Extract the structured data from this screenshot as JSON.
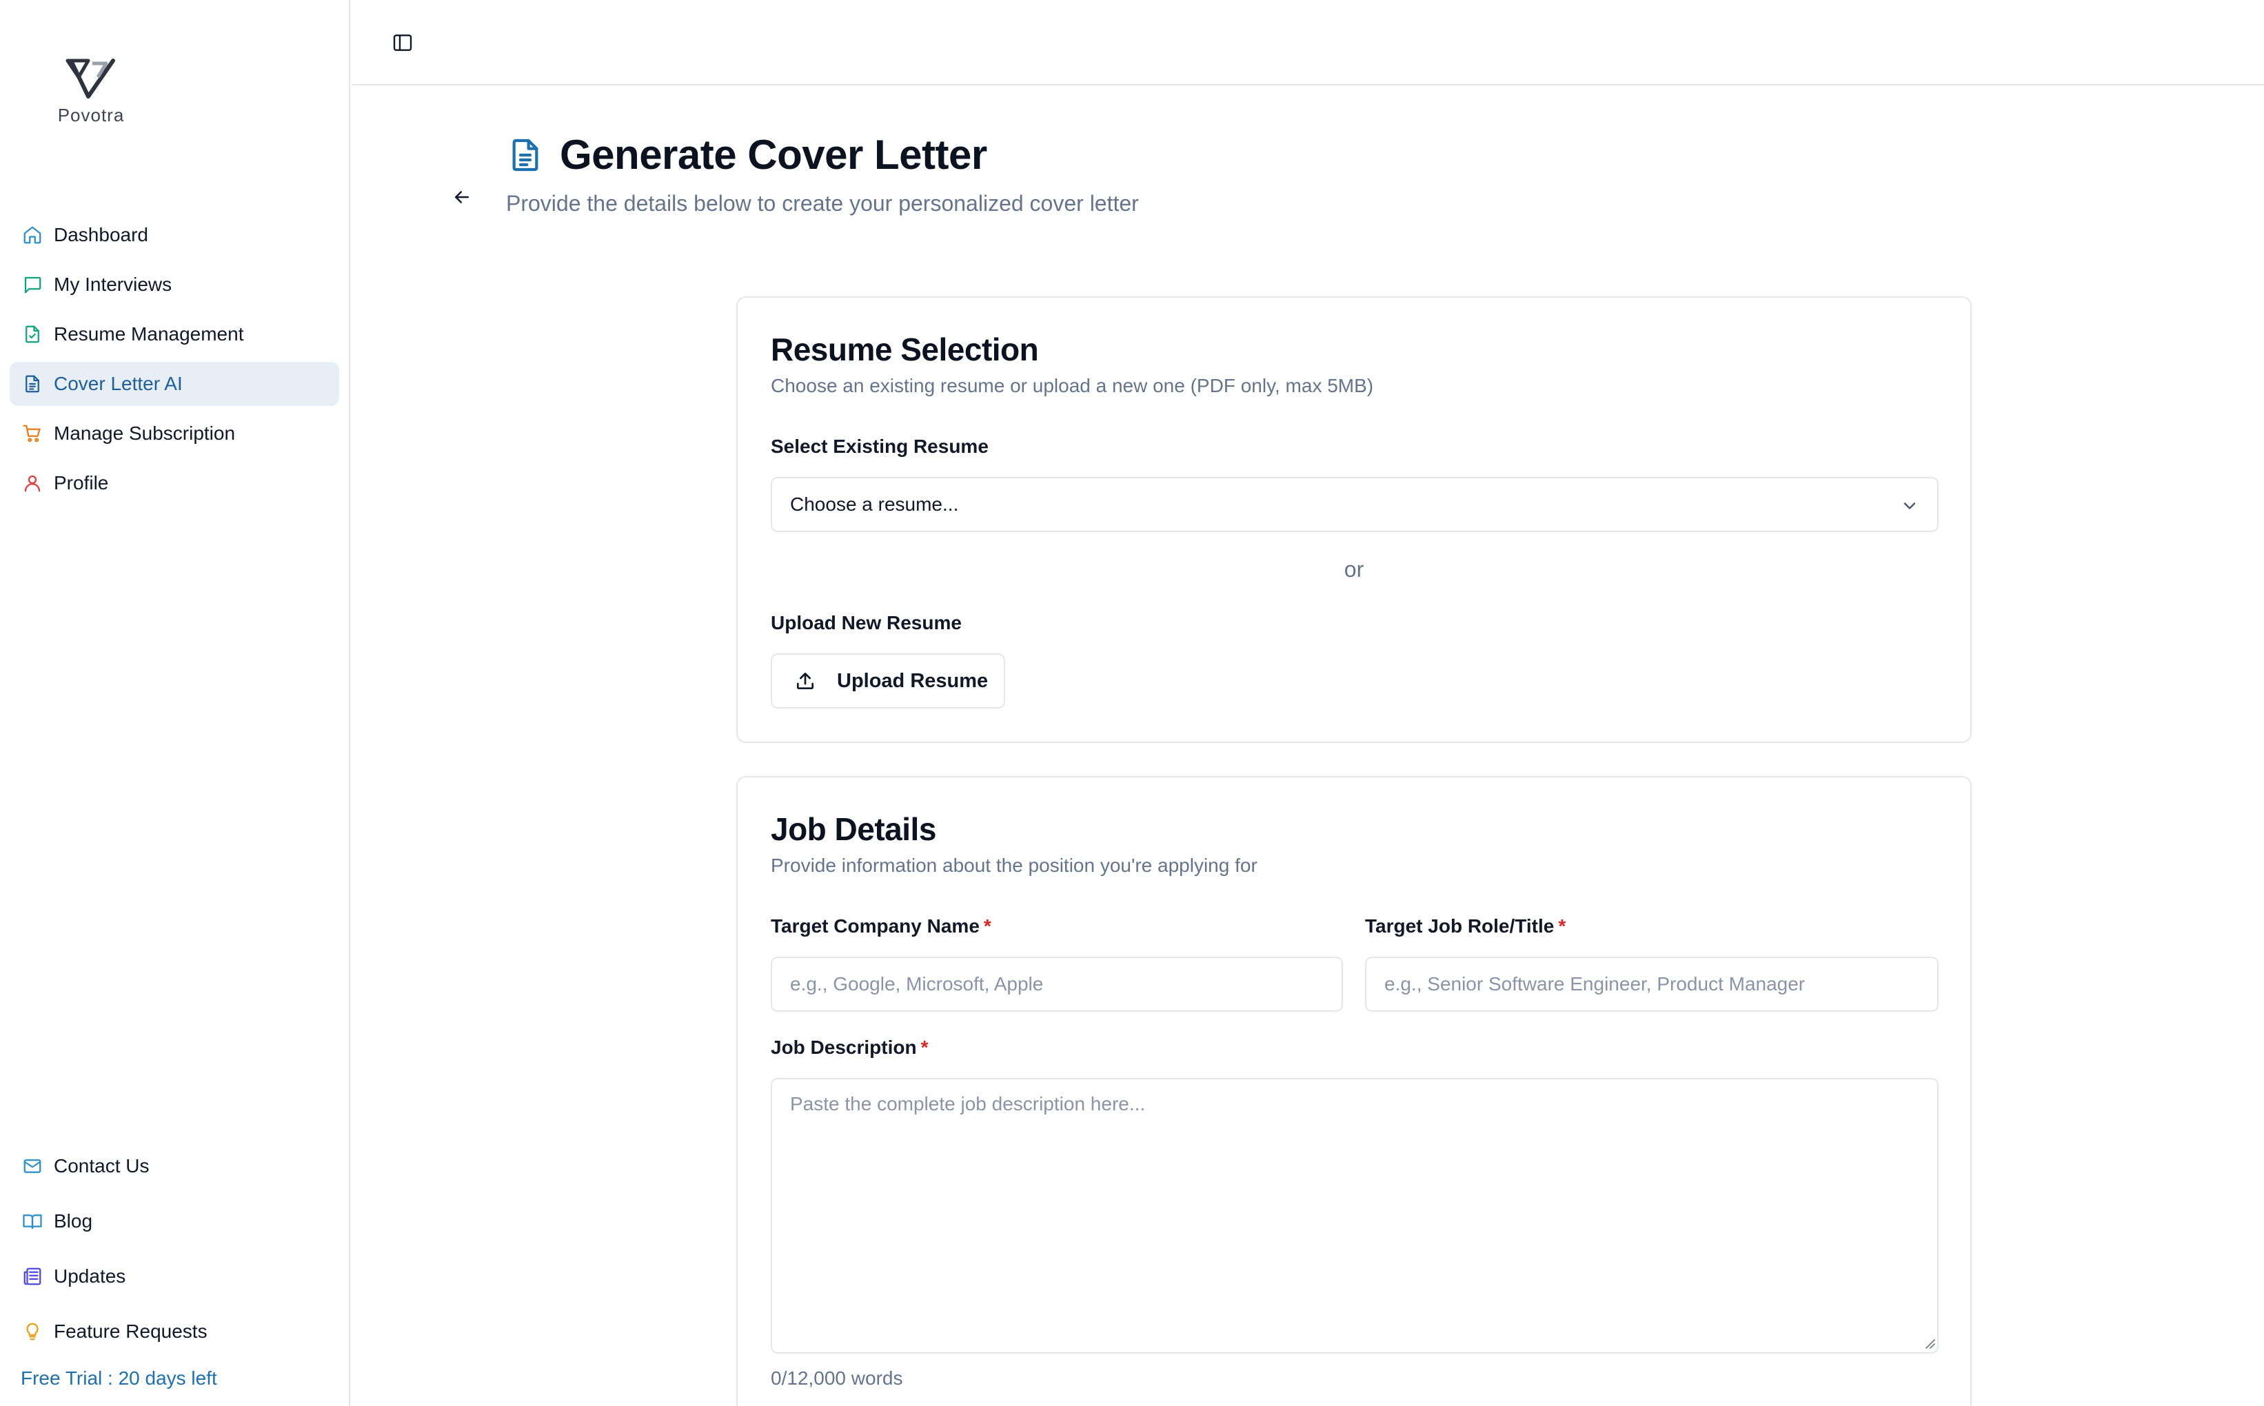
{
  "brand": {
    "name": "Povotra"
  },
  "sidebar": {
    "items": [
      {
        "label": "Dashboard",
        "icon": "home-icon",
        "color": "#2b8fc9"
      },
      {
        "label": "My Interviews",
        "icon": "chat-icon",
        "color": "#10a37f"
      },
      {
        "label": "Resume Management",
        "icon": "file-check-icon",
        "color": "#10a37f"
      },
      {
        "label": "Cover Letter AI",
        "icon": "file-text-icon",
        "color": "#1d5f9b",
        "active": true
      },
      {
        "label": "Manage Subscription",
        "icon": "cart-icon",
        "color": "#ea7a1a"
      },
      {
        "label": "Profile",
        "icon": "user-icon",
        "color": "#e23b3b"
      }
    ],
    "bottom_items": [
      {
        "label": "Contact Us",
        "icon": "mail-icon",
        "color": "#2b8fc9"
      },
      {
        "label": "Blog",
        "icon": "book-icon",
        "color": "#2b8fc9"
      },
      {
        "label": "Updates",
        "icon": "newspaper-icon",
        "color": "#4f46e5"
      },
      {
        "label": "Feature Requests",
        "icon": "lightbulb-icon",
        "color": "#e6a019"
      }
    ],
    "trial_text": "Free Trial : 20 days left"
  },
  "header": {
    "title": "Generate Cover Letter",
    "subtitle": "Provide the details below to create your personalized cover letter"
  },
  "resume_section": {
    "title": "Resume Selection",
    "description": "Choose an existing resume or upload a new one (PDF only, max 5MB)",
    "select_label": "Select Existing Resume",
    "select_value": "Choose a resume...",
    "or_text": "or",
    "upload_label": "Upload New Resume",
    "upload_button": "Upload Resume"
  },
  "job_section": {
    "title": "Job Details",
    "description": "Provide information about the position you're applying for",
    "company_label": "Target Company Name",
    "company_placeholder": "e.g., Google, Microsoft, Apple",
    "role_label": "Target Job Role/Title",
    "role_placeholder": "e.g., Senior Software Engineer, Product Manager",
    "description_label": "Job Description",
    "description_placeholder": "Paste the complete job description here...",
    "required_mark": "*",
    "word_count": "0/12,000 words"
  },
  "colors": {
    "accent": "#1d5f9b",
    "active_bg": "#e8eef6",
    "required": "#dc2626",
    "trial": "#1d6fae"
  }
}
